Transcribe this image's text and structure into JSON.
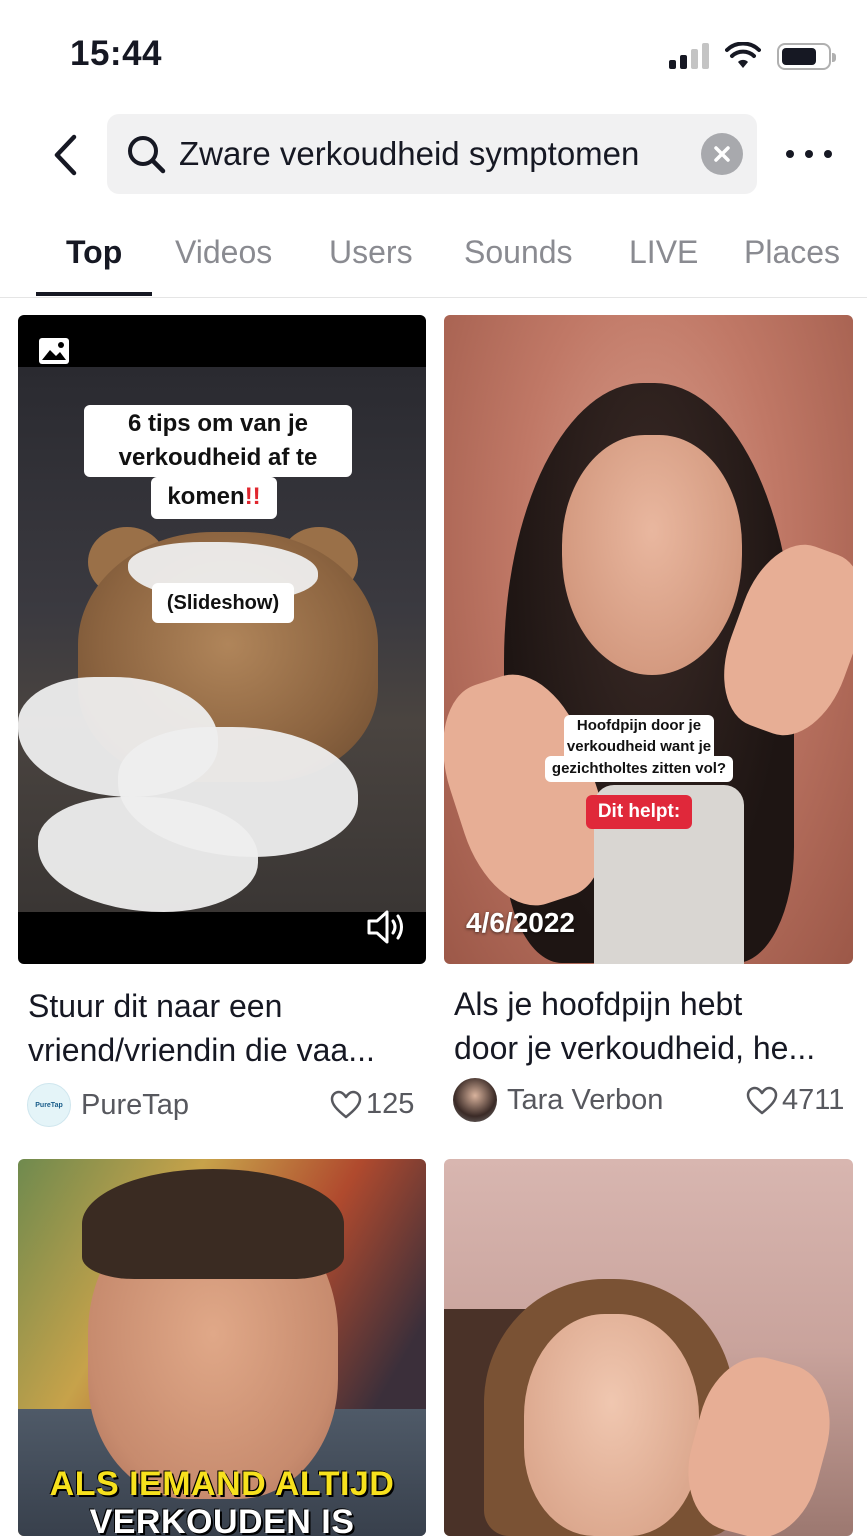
{
  "status_bar": {
    "time": "15:44"
  },
  "search": {
    "query": "Zware verkoudheid symptomen"
  },
  "tabs": [
    {
      "label": "Top",
      "active": true
    },
    {
      "label": "Videos",
      "active": false
    },
    {
      "label": "Users",
      "active": false
    },
    {
      "label": "Sounds",
      "active": false
    },
    {
      "label": "LIVE",
      "active": false
    },
    {
      "label": "Places",
      "active": false
    }
  ],
  "results": [
    {
      "title_line1": "Stuur dit naar een",
      "title_line2": "vriend/vriendin die vaa...",
      "author": "PureTap",
      "avatar_text": "PureTap",
      "likes": "125",
      "overlay_line1": "6 tips om van je",
      "overlay_line2": "verkoudheid af te",
      "overlay_line3": "komen",
      "overlay_emphasis": "!!",
      "overlay_sub": "(Slideshow)",
      "type_icon": "image-slideshow-icon",
      "sound_icon": "speaker-icon"
    },
    {
      "title_line1": "Als je hoofdpijn hebt",
      "title_line2": "door je verkoudheid, he...",
      "author": "Tara Verbon",
      "likes": "4711",
      "overlay_line1": "Hoofdpijn door je",
      "overlay_line2": "verkoudheid want je",
      "overlay_line3": "gezichtholtes zitten vol?",
      "overlay_cta": "Dit helpt:",
      "date": "4/6/2022"
    },
    {
      "caption_line1": "ALS IEMAND ALTIJD",
      "caption_line2": "VERKOUDEN IS"
    },
    {}
  ],
  "colors": {
    "text_primary": "#161823",
    "text_secondary": "#57585e",
    "tab_inactive": "#8a8b91",
    "search_bg": "#f1f1f2",
    "accent_red": "#e0283a",
    "caption_yellow": "#f7e11d"
  }
}
